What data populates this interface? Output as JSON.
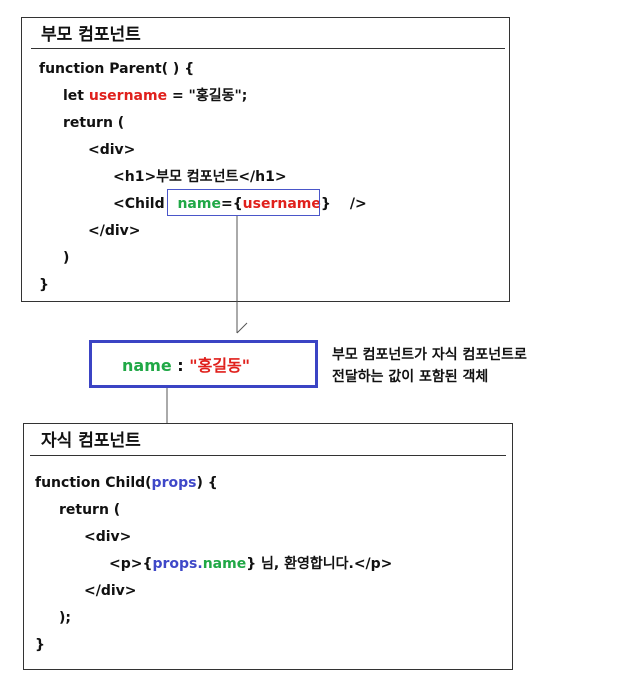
{
  "parent": {
    "title": "부모 컴포넌트",
    "line1": "function Parent( ) {",
    "line2_let": "let ",
    "line2_var": "username",
    "line2_eq": " = \"홍길동\";",
    "line3": "return (",
    "line4": "<div>",
    "line5": "<h1>부모 컴포넌트</h1>",
    "line6_child": "<Child ",
    "line6_prop": "name",
    "line6_eq": "=",
    "line6_open": "{",
    "line6_var": "username",
    "line6_close": "}",
    "line6_end": "/>",
    "line7": "</div>",
    "line8": ")",
    "line9": "}"
  },
  "props_object": {
    "key": "name",
    "separator": " : ",
    "value": "\"홍길동\""
  },
  "note": {
    "line1": "부모 컴포넌트가 자식 컴포넌트로",
    "line2": "전달하는 값이 포함된 객체"
  },
  "child": {
    "title": "자식 컴포넌트",
    "line1_pre": "function Child(",
    "line1_arg": "props",
    "line1_post": ") {",
    "line2": "return (",
    "line3": "<div>",
    "line4_open": "<p>",
    "line4_brace_open": "{",
    "line4_obj": "props",
    "line4_dot": ".",
    "line4_key": "name",
    "line4_brace_close": "}",
    "line4_text": " 님, 환영합니다.</p>",
    "line5": "</div>",
    "line6": ");",
    "line7": "}"
  },
  "colors": {
    "variable": "#e0201c",
    "prop_key": "#20a846",
    "props_object": "#3f48c8",
    "box_border": "#3b44c4"
  }
}
